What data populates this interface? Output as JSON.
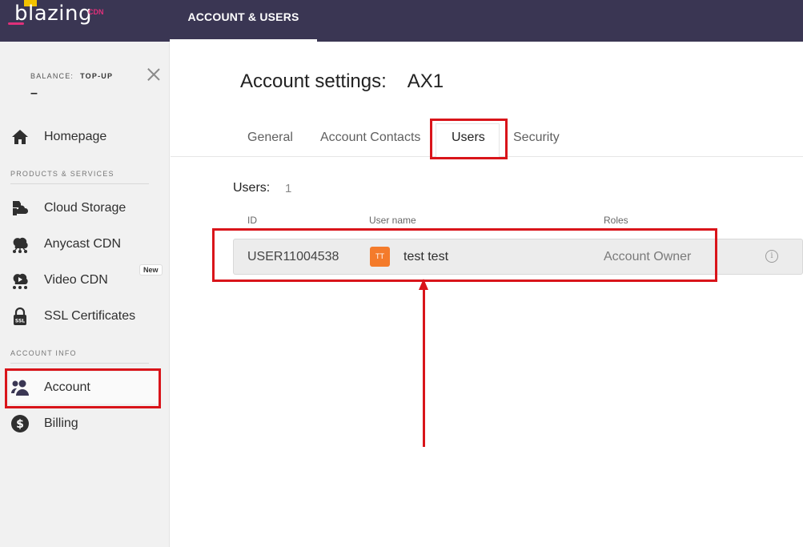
{
  "brand": {
    "logo_text": "blazing",
    "logo_suffix": "CDN"
  },
  "topnav": {
    "active_tab": "ACCOUNT & USERS"
  },
  "sidebar": {
    "balance_label": "BALANCE:",
    "topup_label": "TOP-UP",
    "balance_value": "–",
    "homepage": "Homepage",
    "section_products": "PRODUCTS & SERVICES",
    "items": [
      {
        "label": "Cloud Storage",
        "icon": "cloud-storage-icon"
      },
      {
        "label": "Anycast CDN",
        "icon": "anycast-cdn-icon"
      },
      {
        "label": "Video CDN",
        "icon": "video-cdn-icon",
        "badge": "New"
      },
      {
        "label": "SSL Certificates",
        "icon": "ssl-icon"
      }
    ],
    "section_account": "ACCOUNT INFO",
    "account": "Account",
    "billing": "Billing"
  },
  "main": {
    "title": "Account settings:",
    "account_id": "AX1",
    "tabs": [
      "General",
      "Account Contacts",
      "Users",
      "Security"
    ],
    "active_tab": "Users",
    "users_label": "Users:",
    "users_count": "1",
    "columns": [
      "ID",
      "User name",
      "Roles"
    ],
    "rows": [
      {
        "id": "USER11004538",
        "avatar": "TT",
        "name": "test test",
        "role": "Account Owner"
      }
    ]
  },
  "colors": {
    "topbar": "#3a3653",
    "annotation": "#d9141a",
    "avatar": "#f47b2b"
  }
}
